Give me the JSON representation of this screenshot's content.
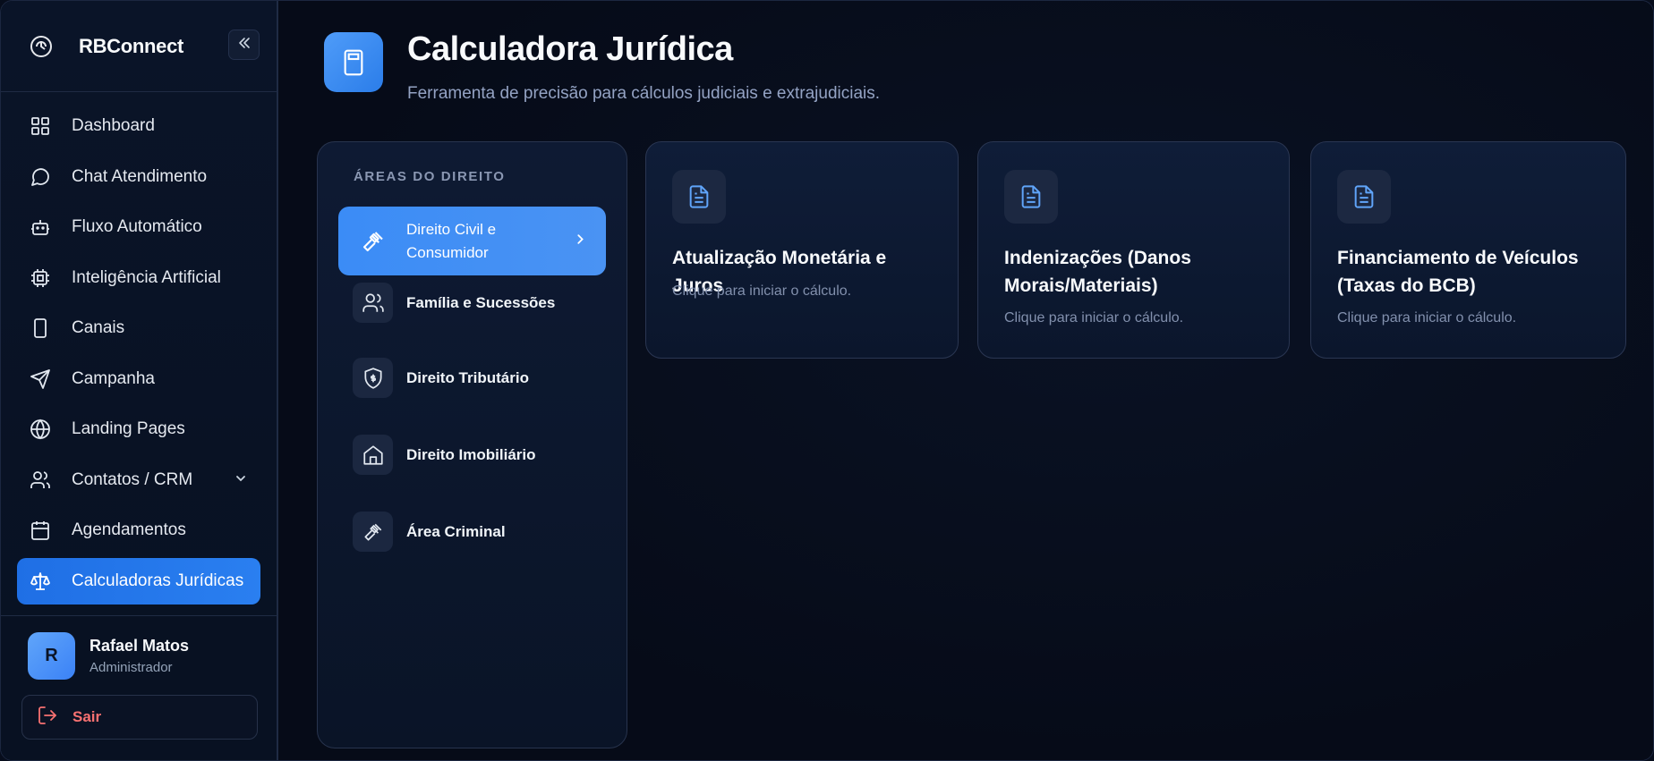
{
  "brand": {
    "name": "RBConnect"
  },
  "nav": {
    "items": [
      {
        "label": "Dashboard",
        "icon": "grid-icon"
      },
      {
        "label": "Chat Atendimento",
        "icon": "chat-icon"
      },
      {
        "label": "Fluxo Automático",
        "icon": "bot-icon"
      },
      {
        "label": "Inteligência Artificial",
        "icon": "cpu-icon"
      },
      {
        "label": "Canais",
        "icon": "smartphone-icon"
      },
      {
        "label": "Campanha",
        "icon": "send-icon"
      },
      {
        "label": "Landing Pages",
        "icon": "globe-icon"
      },
      {
        "label": "Contatos / CRM",
        "icon": "users-icon"
      },
      {
        "label": "Agendamentos",
        "icon": "calendar-icon"
      },
      {
        "label": "Calculadoras Jurídicas",
        "icon": "scale-icon"
      }
    ],
    "active": "Calculadoras Jurídicas"
  },
  "user": {
    "initial": "R",
    "name": "Rafael Matos",
    "role": "Administrador"
  },
  "logout": {
    "label": "Sair"
  },
  "header": {
    "title": "Calculadora Jurídica",
    "subtitle": "Ferramenta de precisão para cálculos judiciais e extrajudiciais."
  },
  "areas": {
    "heading": "ÁREAS DO DIREITO",
    "items": [
      {
        "label": "Direito Civil e Consumidor",
        "icon": "gavel-icon",
        "active": true
      },
      {
        "label": "Família e Sucessões",
        "icon": "users-icon"
      },
      {
        "label": "Direito Tributário",
        "icon": "shield-dollar-icon"
      },
      {
        "label": "Direito Imobiliário",
        "icon": "house-icon"
      },
      {
        "label": "Área Criminal",
        "icon": "gavel-icon"
      }
    ]
  },
  "calculators": [
    {
      "title": "Atualização Monetária e Juros",
      "desc": "Clique para iniciar o cálculo.",
      "icon": "document-icon"
    },
    {
      "title": "Indenizações (Danos Morais/Materiais)",
      "desc": "Clique para iniciar o cálculo.",
      "icon": "document-icon"
    },
    {
      "title": "Financiamento de Veículos (Taxas do BCB)",
      "desc": "Clique para iniciar o cálculo.",
      "icon": "document-icon"
    }
  ],
  "colors": {
    "accent": "#2a7ff0",
    "accent_light": "#3b8cf6",
    "danger": "#f87171",
    "background": "#070d1c"
  }
}
